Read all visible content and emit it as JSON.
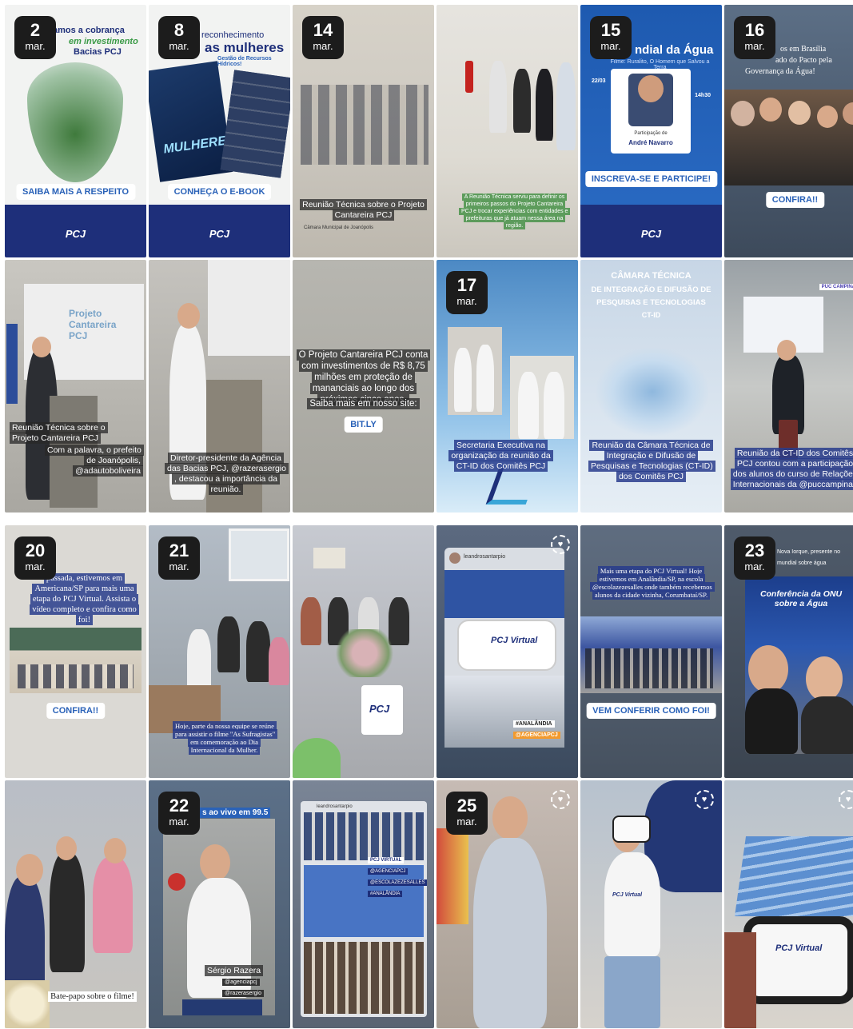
{
  "month": "mar.",
  "tiles": {
    "t1": {
      "day": "2",
      "title": "amos a cobrança",
      "subtitle": "em investimento",
      "title2": "Bacias PCJ",
      "pill": "SAIBA MAIS A RESPEITO",
      "logo": "PCJ"
    },
    "t2": {
      "day": "8",
      "title": "reconhecimento",
      "title2": "as mulheres",
      "subtitle": "Gestão de Recursos Hídricos!",
      "book": "MULHERES",
      "pill": "CONHEÇA O E-BOOK",
      "logo": "PCJ"
    },
    "t3": {
      "day": "14",
      "caption": "Reunião Técnica sobre o Projeto Cantareira PCJ",
      "sub": "Câmara Municipal de Joanópolis"
    },
    "t4": {
      "caption": "A Reunião Técnica serviu para definir os primeiros passos do Projeto Cantareira PCJ e trocar experiências com entidades e prefeituras que já atuam nessa área na região."
    },
    "t5": {
      "day": "15",
      "title": "ndial da Água",
      "subtitle": "Filme: Ruralito, O Homem que Salvou a Terra",
      "date_tag": "22/03",
      "time_tag": "14h30",
      "name_label": "Participação de",
      "name": "André Navarro",
      "pill": "INSCREVA-SE E PARTICIPE!",
      "logo": "PCJ"
    },
    "t6": {
      "day": "16",
      "title": "os em Brasília",
      "title2": "ado do Pacto pela",
      "title3": "Governança da Água!",
      "pill": "CONFIRA!!"
    },
    "t7": {
      "slide": "Projeto Cantareira PCJ",
      "caption": "Reunião Técnica sobre o Projeto Cantareira PCJ",
      "caption2": "Com a palavra, o prefeito de Joanópolis, @adautoboliveira"
    },
    "t8": {
      "caption": "Diretor-presidente da Agência das Bacias PCJ, @razerasergio , destacou a importância da reunião."
    },
    "t9": {
      "text": "O Projeto Cantareira PCJ conta com investimentos de R$ 8,75 milhões em proteção de mananciais ao longo dos próximos cinco anos.",
      "text2": "Saiba mais em nosso site:",
      "pill": "BIT.LY"
    },
    "t10": {
      "day": "17",
      "caption": "Secretaria Executiva na organização da reunião da CT-ID dos Comitês PCJ"
    },
    "t11": {
      "banner1": "CÂMARA TÉCNICA",
      "banner2": "DE INTEGRAÇÃO E DIFUSÃO DE",
      "banner3": "PESQUISAS E TECNOLOGIAS",
      "banner4": "CT-ID",
      "caption": "Reunião da Câmara Técnica de Integração e Difusão de Pesquisas e Tecnologias (CT-ID) dos Comitês PCJ"
    },
    "t12": {
      "tag": "PUC CAMPINAS",
      "caption": "Reunião da CT-ID dos Comitês PCJ contou com a participação dos alunos do curso de Relações Internacionais da @puccampinas"
    },
    "t13": {
      "day": "20",
      "caption": "passada, estivemos em Americana/SP para mais uma etapa do PCJ Virtual. Assista o vídeo completo e confira como foi!",
      "pill": "CONFIRA!!"
    },
    "t14": {
      "day": "21",
      "caption": "Hoje, parte da nossa equipe se reúne para assistir o filme \"As Sufragistas\" em comemoração ao Dia Internacional da Mulher."
    },
    "t15": {
      "mug": "PCJ"
    },
    "t16": {
      "user": "leandrosantarpio",
      "device": "PCJ Virtual",
      "tag1": "#ANALÂNDIA",
      "tag2": "@AGENCIAPCJ"
    },
    "t17": {
      "caption": "Mais uma etapa do PCJ Virtual! Hoje estivemos em Analândia/SP, na escola @escolazezesalles onde também recebemos alunos da cidade vizinha, Corumbataí/SP.",
      "pill": "VEM CONFERIR COMO FOI!"
    },
    "t18": {
      "day": "23",
      "title": "Nova Iorque, presente no",
      "title2": "mundial sobre água",
      "banner": "Conferência da ONU sobre a Água"
    },
    "t19": {
      "caption": "Bate-papo sobre o filme!"
    },
    "t20": {
      "day": "22",
      "title": "s ao vivo em 99.5",
      "name": "Sérgio Razera",
      "tag1": "@agenciapcj",
      "tag2": "@razerasergio"
    },
    "t21": {
      "user": "leandrosantarpio",
      "tag1": "PCJ VIRTUAL",
      "tag2": "@AGENCIAPCJ",
      "tag3": "@ESCOLAZEZESALLES",
      "tag4": "#ANALÂNDIA"
    },
    "t22": {
      "day": "25"
    },
    "t23": {
      "device": "PCJ Virtual"
    },
    "t24": {
      "device": "PCJ Virtual"
    }
  }
}
